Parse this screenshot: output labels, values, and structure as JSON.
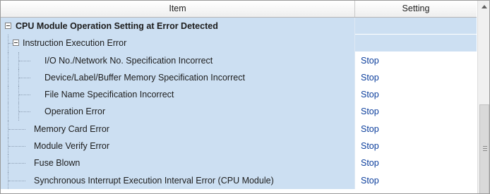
{
  "columns": {
    "item": "Item",
    "setting": "Setting"
  },
  "rows": [
    {
      "label": "CPU Module Operation Setting at Error Detected",
      "value": "",
      "level": 0,
      "expander": true,
      "bold": true
    },
    {
      "label": "Instruction Execution Error",
      "value": "",
      "level": 1,
      "expander": true,
      "bold": false
    },
    {
      "label": "I/O No./Network No. Specification Incorrect",
      "value": "Stop",
      "level": 2,
      "expander": false,
      "bold": false
    },
    {
      "label": "Device/Label/Buffer Memory Specification Incorrect",
      "value": "Stop",
      "level": 2,
      "expander": false,
      "bold": false
    },
    {
      "label": "File Name Specification Incorrect",
      "value": "Stop",
      "level": 2,
      "expander": false,
      "bold": false
    },
    {
      "label": "Operation Error",
      "value": "Stop",
      "level": 2,
      "expander": false,
      "bold": false
    },
    {
      "label": "Memory Card Error",
      "value": "Stop",
      "level": 1,
      "expander": false,
      "bold": false
    },
    {
      "label": "Module Verify Error",
      "value": "Stop",
      "level": 1,
      "expander": false,
      "bold": false
    },
    {
      "label": "Fuse Blown",
      "value": "Stop",
      "level": 1,
      "expander": false,
      "bold": false
    },
    {
      "label": "Synchronous Interrupt Execution Interval Error (CPU Module)",
      "value": "Stop",
      "level": 1,
      "expander": false,
      "bold": false
    }
  ],
  "colors": {
    "row_highlight": "#ccdff2",
    "value_text": "#0a3d9c"
  },
  "icons": {
    "expander": "collapse-minus-icon",
    "scroll_up": "scroll-up-arrow-icon"
  }
}
